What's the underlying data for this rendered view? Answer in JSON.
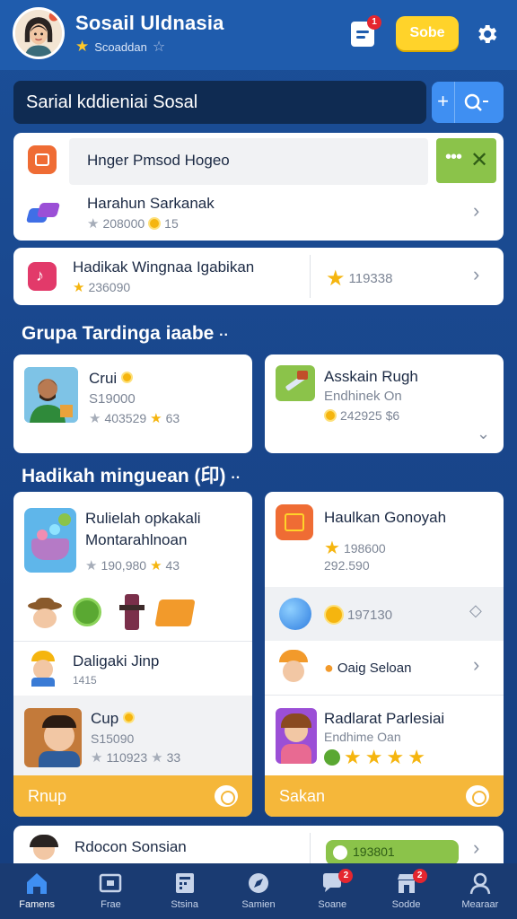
{
  "header": {
    "title": "Sosail Uldnasia",
    "subtitle": "Scoaddan",
    "notif_count": "1",
    "action_label": "Sobe"
  },
  "search": {
    "value": "Sarial kddieniai Sosal"
  },
  "list": [
    {
      "title": "Hnger Pmsod Hogeo"
    },
    {
      "title": "Harahun Sarkanak",
      "meta1": "208000",
      "meta2": "15"
    },
    {
      "title": "Hadikak Wingnaa Igabikan",
      "meta1": "236090",
      "meta2": "119338"
    }
  ],
  "section1": {
    "title": "Grupa Tardinga iaabe",
    "cards": [
      {
        "title": "Crui",
        "line2": "S19000",
        "meta1": "403529",
        "meta2": "63"
      },
      {
        "title": "Asskain Rugh",
        "line2": "Endhinek On",
        "meta1": "242925 $6"
      }
    ]
  },
  "section2": {
    "title": "Hadikah minguean (印)",
    "left": {
      "title": "Rulielah opkakali Montarahlnoan",
      "meta1": "190,980",
      "meta2": "43",
      "row_title": "Daligaki Jinp",
      "row_sub": "1415",
      "item_title": "Cup",
      "item_line2": "S15090",
      "item_meta1": "110923",
      "item_meta2": "33",
      "footer": "Rnup"
    },
    "right": {
      "title": "Haulkan Gonoyah",
      "line2": "198600",
      "line3": "292.590",
      "coin_value": "197130",
      "row_title": "Oaig Seloan",
      "item_title": "Radlarat Parlesiai",
      "item_line2": "Endhime Oan",
      "footer": "Sakan"
    }
  },
  "bottom_card": {
    "title": "Rdocon Sonsian",
    "value": "193801"
  },
  "nav": [
    {
      "label": "Famens",
      "badge": ""
    },
    {
      "label": "Frae",
      "badge": ""
    },
    {
      "label": "Stsina",
      "badge": ""
    },
    {
      "label": "Samien",
      "badge": ""
    },
    {
      "label": "Soane",
      "badge": "2"
    },
    {
      "label": "Sodde",
      "badge": "2"
    },
    {
      "label": "Mearaar",
      "badge": ""
    }
  ],
  "colors": {
    "background": "#1b4f98",
    "accent": "#3f8ff2",
    "yellow": "#ffd32a",
    "footer": "#f5b73a",
    "badge": "#e5262f"
  }
}
